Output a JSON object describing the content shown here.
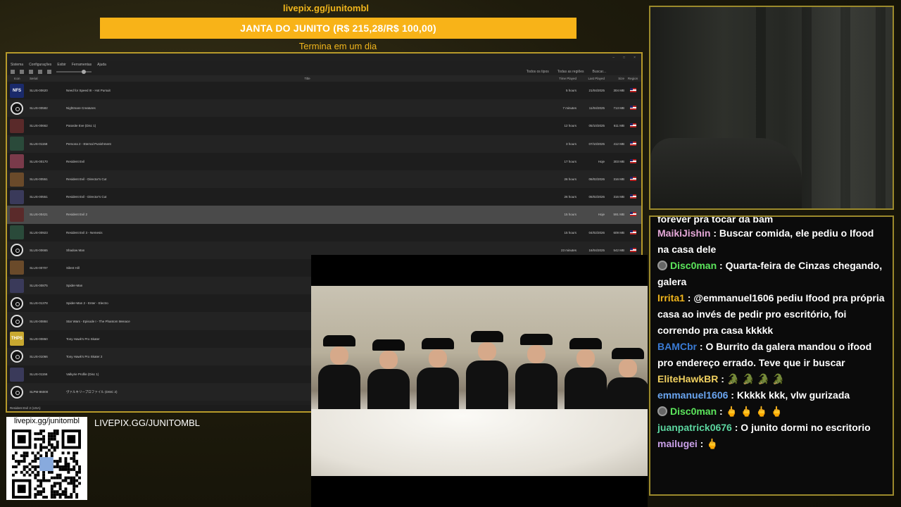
{
  "donation": {
    "url": "livepix.gg/junitombl",
    "goal_text": "JANTA DO JUNITO (R$ 215,28/R$ 100,00)",
    "subtitle": "Termina em um dia",
    "progress_fraction": 1.0,
    "bar_color": "#f8b318"
  },
  "emulator": {
    "menu": [
      "Sistema",
      "Configurações",
      "Exibir",
      "Ferramentas",
      "Ajuda"
    ],
    "toolbar_right": [
      "Todos os tipos",
      "Todas as regiões",
      "Buscar..."
    ],
    "columns": {
      "icon": "Icon",
      "serial": "Serial",
      "title": "Title",
      "time": "Time Played",
      "last": "Last Played",
      "size": "Size",
      "region": "Region"
    },
    "rows": [
      {
        "icon": "NFS",
        "serial": "SLUS-00620",
        "title": "Need for Speed III - Hot Pursuit",
        "time": "5 hours",
        "last": "21/04/2025",
        "size": "304 MB"
      },
      {
        "icon": "disc",
        "serial": "SLUS-00582",
        "title": "Nightmare Creatures",
        "time": "7 minutes",
        "last": "11/04/2025",
        "size": "713 MB"
      },
      {
        "icon": "art",
        "serial": "SLUS-00662",
        "title": "Parasite Eve (Disc 1)",
        "time": "12 hours",
        "last": "05/10/2025",
        "size": "611 MB"
      },
      {
        "icon": "art",
        "serial": "SLUS-01158",
        "title": "Persona 2 - Eternal Punishment",
        "time": "3 hours",
        "last": "07/10/2025",
        "size": "412 MB"
      },
      {
        "icon": "art",
        "serial": "SLUS-00170",
        "title": "Resident Evil",
        "time": "17 hours",
        "last": "Hoje",
        "size": "303 MB"
      },
      {
        "icon": "art",
        "serial": "SLUS-00551",
        "title": "Resident Evil - Director's Cut",
        "time": "26 hours",
        "last": "06/02/2026",
        "size": "316 MB"
      },
      {
        "icon": "art",
        "serial": "SLUS-00551",
        "title": "Resident Evil - Director's Cut",
        "time": "26 hours",
        "last": "06/02/2026",
        "size": "316 MB"
      },
      {
        "icon": "art",
        "serial": "SLUS-00421",
        "title": "Resident Evil 2",
        "time": "15 hours",
        "last": "Hoje",
        "size": "591 MB",
        "selected": true
      },
      {
        "icon": "art",
        "serial": "SLUS-00923",
        "title": "Resident Evil 3 - Nemesis",
        "time": "15 hours",
        "last": "04/02/2026",
        "size": "609 MB"
      },
      {
        "icon": "disc",
        "serial": "SLUS-00665",
        "title": "Shadow Man",
        "time": "23 minutes",
        "last": "16/04/2025",
        "size": "542 MB"
      },
      {
        "icon": "art",
        "serial": "SLUS-00707",
        "title": "Silent Hill",
        "time": "",
        "last": "",
        "size": ""
      },
      {
        "icon": "art",
        "serial": "SLUS-00875",
        "title": "Spider-Man",
        "time": "",
        "last": "",
        "size": ""
      },
      {
        "icon": "disc",
        "serial": "SLUS-01378",
        "title": "Spider-Man 2 - Enter - Electro",
        "time": "",
        "last": "",
        "size": ""
      },
      {
        "icon": "disc",
        "serial": "SLUS-00884",
        "title": "Star Wars - Episode I - The Phantom Menace",
        "time": "",
        "last": "",
        "size": ""
      },
      {
        "icon": "THPS",
        "serial": "SLUS-00860",
        "title": "Tony Hawk's Pro Skater",
        "time": "",
        "last": "",
        "size": ""
      },
      {
        "icon": "disc",
        "serial": "SLUS-01066",
        "title": "Tony Hawk's Pro Skater 2",
        "time": "",
        "last": "",
        "size": ""
      },
      {
        "icon": "art",
        "serial": "SLUS-01156",
        "title": "Valkyrie Profile (Disc 1)",
        "time": "",
        "last": "",
        "size": ""
      },
      {
        "icon": "disc",
        "serial": "SLPM-86000",
        "title": "ヴァルキリープロファイル (DISC 2)",
        "time": "",
        "last": "",
        "size": ""
      }
    ],
    "status": "Resident Evil 2 (USA)"
  },
  "chat": {
    "cut_line": "forever pra tocar da bam",
    "messages": [
      {
        "user": "MaikiJishin",
        "color": "#e6a9d9",
        "badge": false,
        "text": "Buscar comida, ele pediu o Ifood na casa dele"
      },
      {
        "user": "Disc0man",
        "color": "#5ce65c",
        "badge": true,
        "text": "Quarta-feira de Cinzas chegando, galera"
      },
      {
        "user": "Irrita1",
        "color": "#f0b51c",
        "badge": false,
        "text": "@emmanuel1606 pediu Ifood pra própria casa ao invés de pedir pro escritório, foi correndo pra casa kkkkk"
      },
      {
        "user": "BAMCbr",
        "color": "#3a7bd5",
        "badge": false,
        "text": "O Burrito da galera mandou o ifood pro endereço errado. Teve que ir buscar"
      },
      {
        "user": "EliteHawkBR",
        "color": "#f0d060",
        "badge": false,
        "text": "🐊 🐊 🐊 🐊"
      },
      {
        "user": "emmanuel1606",
        "color": "#6aa5f0",
        "badge": false,
        "text": "Kkkkk kkk, vlw gurizada"
      },
      {
        "user": "Disc0man",
        "color": "#5ce65c",
        "badge": true,
        "text": "🖕 🖕 🖕 🖕"
      },
      {
        "user": "juanpatrick0676",
        "color": "#5cd6a0",
        "badge": false,
        "text": "O junito dormi no escritorio"
      },
      {
        "user": "mailugei",
        "color": "#c9a0e8",
        "badge": false,
        "text": "🖕"
      }
    ]
  },
  "qr": {
    "url": "livepix.gg/junitombl",
    "big_url": "LIVEPIX.GG/JUNITOMBL"
  }
}
